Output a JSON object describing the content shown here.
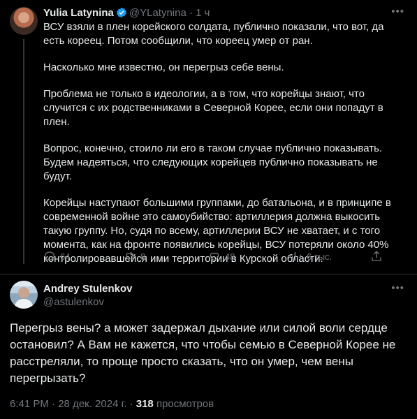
{
  "tweet": {
    "author_name": "Yulia Latynina",
    "author_handle": "@YLatynina",
    "time": "· 1 ч",
    "paragraphs": [
      "ВСУ взяли в плен корейского солдата, публично показали, что вот, да есть кореец. Потом сообщили, что кореец умер от ран.",
      "Насколько мне известно, он перегрыз себе вены.",
      "Проблема не только в идеологии, а в том, что корейцы знают, что случится с их родственниками в Северной Корее, если они попадут в плен.",
      "Вопрос, конечно, стоило ли его в таком случае публично показывать. Будем надеяться, что следующих корейцев публично показывать не будут.",
      "Корейцы наступают большими группами, до батальона, и в принципе в современной войне это самоубийство: артиллерия должна выкосить такую группу. Но, судя по всему, артиллерии ВСУ не хватает, и с того момента, как на фронте появились корейцы, ВСУ потеряли около 40% контролировавшейся ими территории в Курской области."
    ],
    "replies": "64",
    "reposts": "8",
    "likes": "48",
    "views": "6 тыс."
  },
  "reply": {
    "author_name": "Andrey Stulenkov",
    "author_handle": "@astulenkov",
    "text": "Перегрыз вены? а может задержал дыхание или силой воли сердце остановил? А Вам не кажется, что чтобы семью в Северной Корее не расстреляли, то проще просто сказать, что он умер, чем вены перегрызать?",
    "time": "6:41 PM",
    "date": "· 28 дек. 2024 г. ·",
    "views_count": "318",
    "views_label": "просмотров"
  },
  "icons": {
    "more": "more-icon",
    "verified": "verified-badge-icon",
    "reply": "reply-icon",
    "repost": "repost-icon",
    "like": "like-icon",
    "views": "views-icon",
    "share": "share-icon"
  },
  "colors": {
    "accent": "#1d9bf0",
    "muted": "#71767b",
    "text": "#e7e9ea",
    "background": "#000000"
  }
}
